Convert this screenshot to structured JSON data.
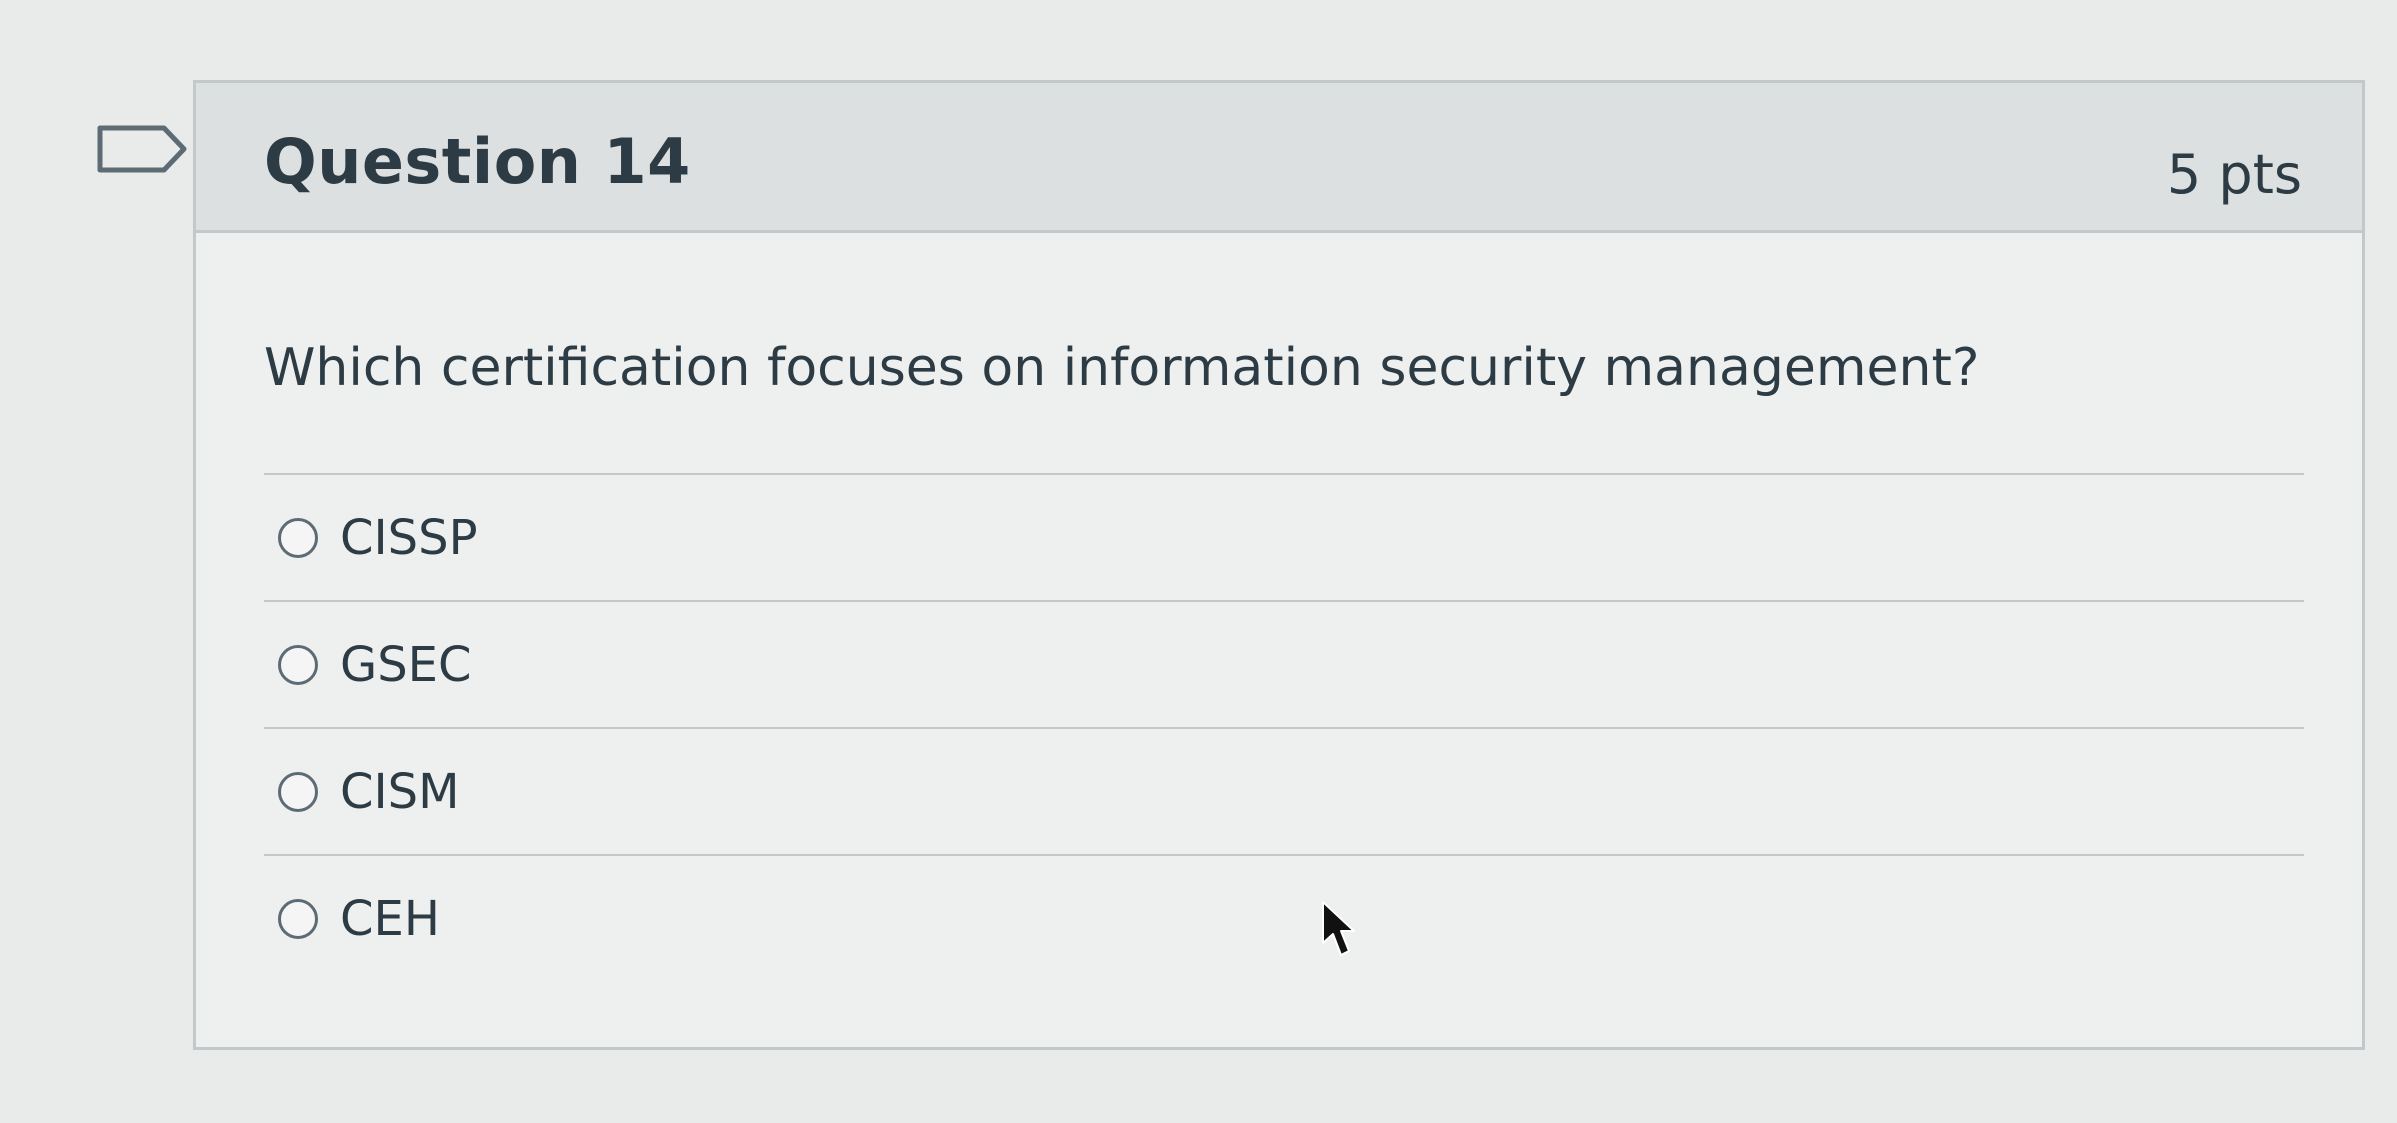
{
  "question": {
    "title": "Question 14",
    "points": "5 pts",
    "text": "Which certification focuses on information security management?",
    "answers": [
      {
        "label": "CISSP"
      },
      {
        "label": "GSEC"
      },
      {
        "label": "CISM"
      },
      {
        "label": "CEH"
      }
    ]
  },
  "icons": {
    "flag": "flag-icon",
    "cursor": "mouse-pointer-icon"
  },
  "colors": {
    "page_background": "#e9ebea",
    "header_background": "#dde0e1",
    "text": "#2d3b45",
    "border": "#c3c8cb"
  }
}
